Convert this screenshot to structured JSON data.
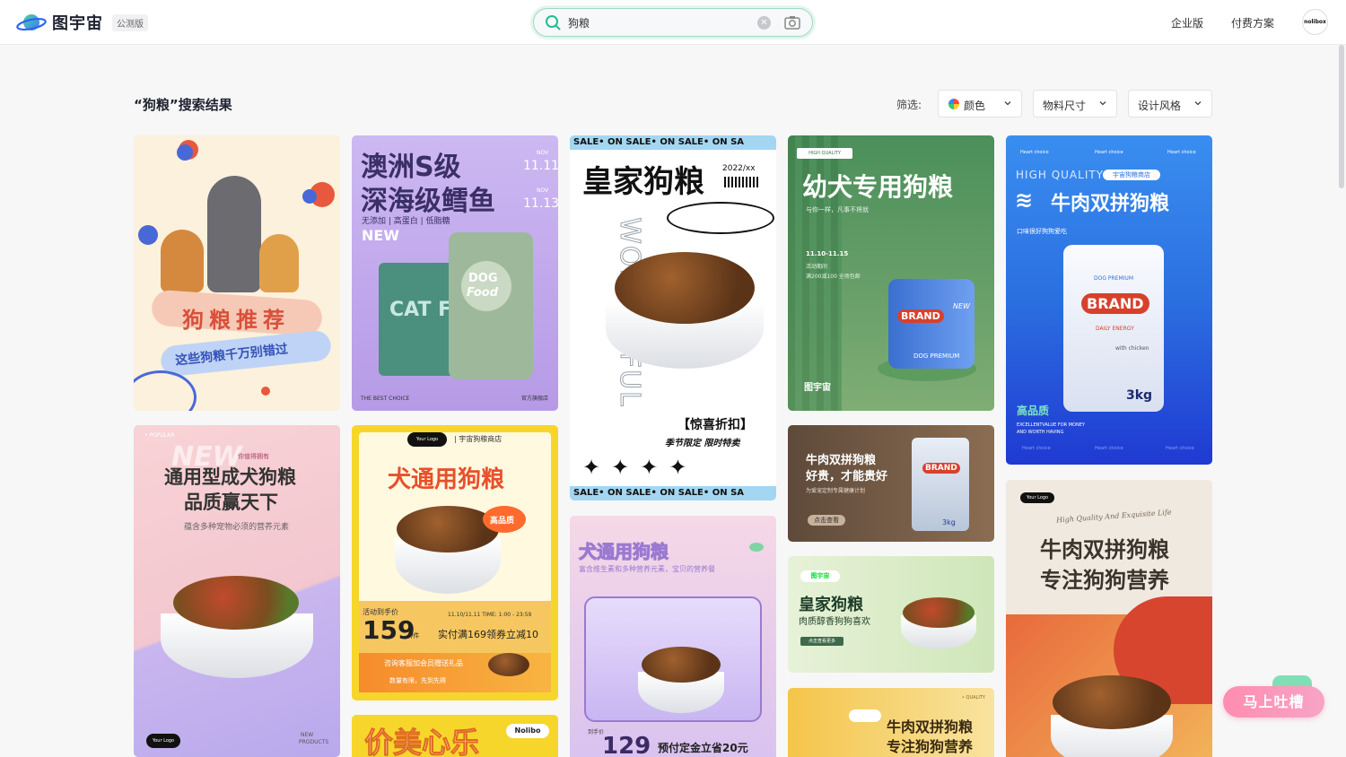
{
  "header": {
    "app_name": "图宇宙",
    "beta_badge": "公测版",
    "search": {
      "value": "狗粮",
      "placeholder": ""
    },
    "nav": [
      "企业版",
      "付费方案"
    ],
    "avatar_text": "nolibox"
  },
  "results": {
    "title": "“狗粮”搜索结果",
    "filter_label": "筛选:",
    "filters": [
      "颜色",
      "物料尺寸",
      "设计风格"
    ]
  },
  "cards": {
    "c1": {
      "title": "狗粮推荐",
      "subtitle": "这些狗粮千万别错过"
    },
    "c2": {
      "title_line1": "澳洲S级",
      "title_line2": "深海级鳕鱼",
      "features": "无添加 | 高蛋白 | 低脂糖",
      "new_tag": "NEW",
      "date1_month": "NOV",
      "date1": "11.11",
      "date2_month": "NOV",
      "date2": "11.13",
      "pack1": "CAT Fo",
      "pack2_line1": "DOG",
      "pack2_line2": "Food",
      "footer_left": "THE BEST CHOICE",
      "footer_right": "官方旗舰店"
    },
    "c3": {
      "marquee": "SALE• ON  SALE• ON  SALE• ON  SA",
      "title": "皇家狗粮",
      "date": "2022/xx",
      "vertical": "WONDERFUL",
      "promo": "【惊喜折扣】",
      "sub": "季节限定  限时特卖",
      "marquee_bottom": "SALE• ON  SALE• ON  SALE• ON  SA"
    },
    "c4": {
      "tag": "HIGH QUALITY",
      "title": "幼犬专用狗粮",
      "subtitle": "与你一样，凡事不将就",
      "date": "11.10-11.15",
      "event": "活动期间",
      "offer": "满200减100 全场包邮",
      "can_brand": "BRAND",
      "can_new": "NEW",
      "can_sub": "DOG PREMIUM",
      "brand_footer": "图宇宙"
    },
    "c5": {
      "top_labels": [
        "Heart choice",
        "Heart choice",
        "Heart choice"
      ],
      "hq": "HIGH QUALITY",
      "shop_tag": "宇宙狗粮商店",
      "title": "牛肉双拼狗粮",
      "desc": "口味很好狗狗爱吃",
      "pack_top": "DOG PREMIUM",
      "pack_brand": "BRAND",
      "pack_sub": "DAILY ENERGY",
      "pack_flavor": "with chicken",
      "pack_weight": "3kg",
      "quality": "高品质",
      "eng1": "EXCELLENTVALUE FOR MONEY",
      "eng2": "AND WORTH HAVING",
      "bottom_labels": [
        "Heart choice",
        "Heart choice",
        "Heart choice"
      ]
    },
    "c6": {
      "popular": "• POPULAR",
      "new_word": "NEW",
      "small": "你值得拥有",
      "title_line1": "通用型成犬狗粮",
      "title_line2": "品质赢天下",
      "desc": "蕴含多种宠物必须的营养元素",
      "logo": "Your Logo",
      "bottom_right_line1": "NEW",
      "bottom_right_line2": "PRODUCTS"
    },
    "c7": {
      "logo": "Your Logo",
      "shop": "| 宇宙狗粮商店",
      "title": "犬通用狗粮",
      "badge": "高品质",
      "price_label": "活动到手价",
      "price": "159",
      "price_unit": "/件",
      "time": "11.10/11.11   TIME: 1:00 - 23:59",
      "offer": "实付满169领券立减10",
      "consult": "咨询客服加会员赠送礼品",
      "limit": "数量有限，先到先得"
    },
    "c8": {
      "title": "价美心乐",
      "brand": "Nolibo"
    },
    "c9": {
      "title": "犬通用狗粮",
      "desc": "富含维生素和多种营养元素，宝贝的营养餐",
      "price_label": "到手价",
      "price": "129",
      "offer": "预付定金立省20元"
    },
    "c10": {
      "title_line1": "牛肉双拼狗粮",
      "title_line2": "好贵，才能贵好",
      "desc": "为爱宠定制专属健康计划",
      "button": "点击查看",
      "pack_brand": "BRAND",
      "pack_weight": "3kg"
    },
    "c11": {
      "brand": "图宇宙",
      "title": "皇家狗粮",
      "subtitle": "肉质醇香狗狗喜欢",
      "button": "点击查看更多"
    },
    "c12": {
      "small": "• QUALITY",
      "title_line1": "牛肉双拼狗粮",
      "title_line2": "专注狗狗营养"
    },
    "c13": {
      "logo": "Your Logo",
      "arc": "High Quality And Exquisite Life",
      "title_line1": "牛肉双拼狗粮",
      "title_line2": "专注狗狗营养"
    }
  },
  "feedback": {
    "label": "马上吐槽"
  },
  "colors": {
    "accent": "#1fbf8f",
    "search_border": "#9fd9c2"
  }
}
